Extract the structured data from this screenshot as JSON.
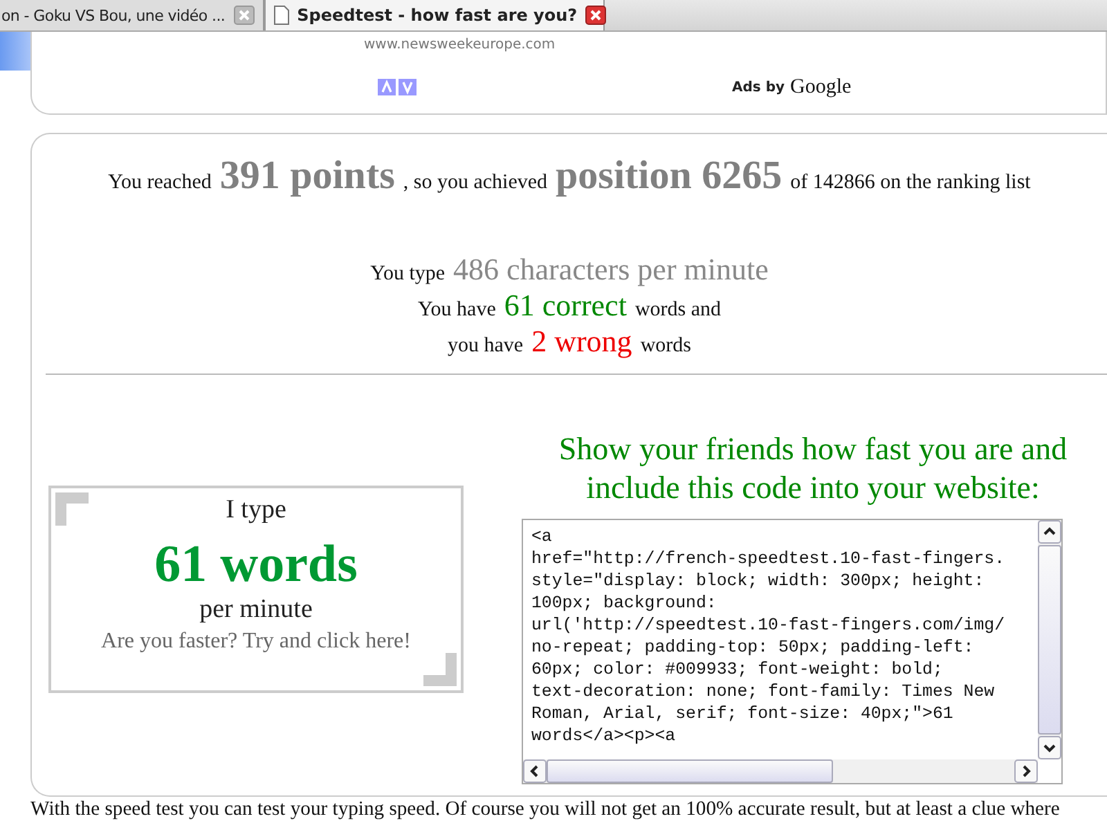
{
  "tabs": [
    {
      "label": "on - Goku VS Bou, une vidéo ...",
      "selected": false
    },
    {
      "label": "Speedtest - how fast are you?",
      "selected": true
    }
  ],
  "ad": {
    "url": "www.newsweekeurope.com",
    "ads_label": "Ads by",
    "brand": "Google"
  },
  "results": [
    [
      {
        "text": "You reached",
        "kind": "plain"
      },
      {
        "text": "391 points",
        "kind": "big"
      },
      {
        "text": ", so you achieved",
        "kind": "plain"
      },
      {
        "text": "position 6265",
        "kind": "big"
      },
      {
        "text": "of 142866 on the ranking list",
        "kind": "plain"
      }
    ],
    [
      {
        "text": "You type",
        "kind": "plain"
      },
      {
        "text": "486 characters per minute",
        "kind": "gray"
      }
    ],
    [
      {
        "text": "You have",
        "kind": "plain"
      },
      {
        "text": "61 correct",
        "kind": "green"
      },
      {
        "text": "words and",
        "kind": "plain"
      }
    ],
    [
      {
        "text": "you have",
        "kind": "plain"
      },
      {
        "text": "2 wrong",
        "kind": "red"
      },
      {
        "text": "words",
        "kind": "plain"
      }
    ]
  ],
  "badge": {
    "line_1": "I type",
    "count": "61 words",
    "line_2": "per minute",
    "link": "Are you faster? Try and click here!"
  },
  "share": {
    "heading": "Show your friends how fast you are and include this code into your website:",
    "code_lines": [
      "<a",
      "href=\"http://french-speedtest.10-fast-fingers.",
      "style=\"display: block; width: 300px; height:",
      "100px; background:",
      "url('http://speedtest.10-fast-fingers.com/img/",
      "no-repeat; padding-top: 50px; padding-left:",
      "60px; color: #009933; font-weight: bold;",
      "text-decoration: none; font-family: Times New",
      "Roman, Arial, serif; font-size: 40px;\">61",
      "words</a><p><a"
    ]
  },
  "footer": "With the speed test you can test your typing speed. Of course you will not get an 100% accurate result, but at least a clue where"
}
